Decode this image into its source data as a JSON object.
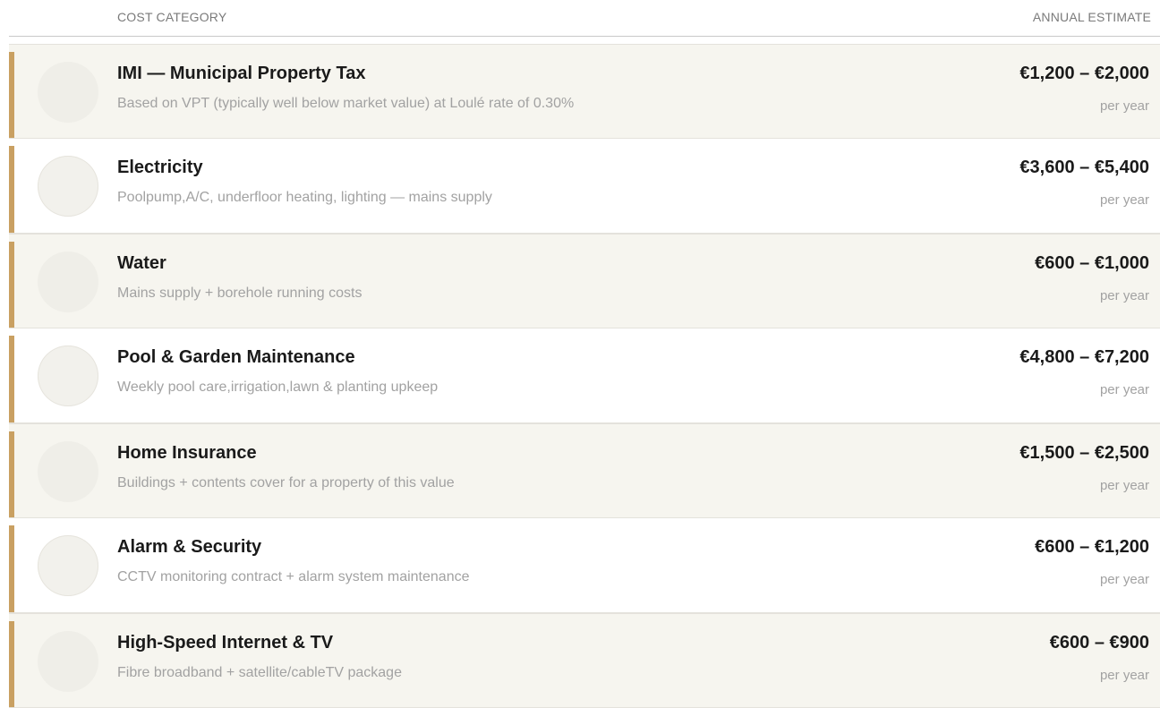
{
  "header": {
    "category_label": "COST CATEGORY",
    "estimate_label": "ANNUAL ESTIMATE"
  },
  "colors": {
    "accent": "#c9a062",
    "row_shade": "#f6f5ef"
  },
  "rows": [
    {
      "title": "IMI — Municipal Property Tax",
      "description": "Based on VPT (typically well below market value) at Loulé rate of 0.30%",
      "amount": "€1,200 – €2,000",
      "period": "per year"
    },
    {
      "title": "Electricity",
      "description": "Poolpump,A/C, underfloor heating, lighting — mains supply",
      "amount": "€3,600 – €5,400",
      "period": "per year"
    },
    {
      "title": "Water",
      "description": "Mains supply + borehole running costs",
      "amount": "€600 – €1,000",
      "period": "per year"
    },
    {
      "title": "Pool & Garden Maintenance",
      "description": "Weekly pool care,irrigation,lawn & planting upkeep",
      "amount": "€4,800 – €7,200",
      "period": "per year"
    },
    {
      "title": "Home Insurance",
      "description": "Buildings + contents cover for a property of this value",
      "amount": "€1,500 – €2,500",
      "period": "per year"
    },
    {
      "title": "Alarm & Security",
      "description": "CCTV monitoring contract + alarm system maintenance",
      "amount": "€600 – €1,200",
      "period": "per year"
    },
    {
      "title": "High-Speed Internet & TV",
      "description": "Fibre broadband + satellite/cableTV package",
      "amount": "€600 – €900",
      "period": "per year"
    }
  ]
}
